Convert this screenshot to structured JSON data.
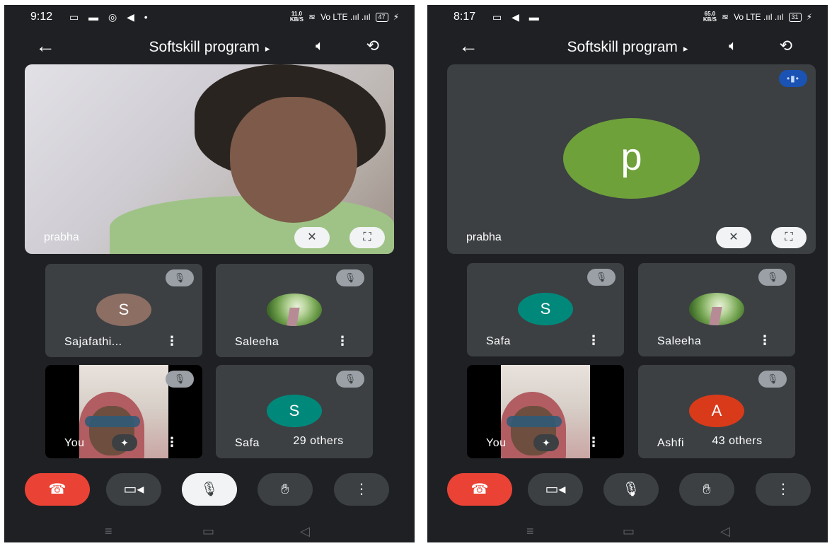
{
  "colors": {
    "background": "#1f2024",
    "tile": "#3c4043",
    "end_call": "#ea4335",
    "avatar_sajafathi": "#8d6e63",
    "avatar_safa": "#00897b",
    "avatar_ashfi": "#d93b1a",
    "avatar_prabha": "#6ea13a",
    "speaking_indicator": "#1a53b3"
  },
  "left": {
    "status": {
      "time": "9:12",
      "app_icons": "▭ ▬ ◎ ◀ •",
      "speed_value": "11.0",
      "speed_unit": "KB/S",
      "wifi_icon": "wifi-icon",
      "signal": "Vo LTE .ııl .ııl",
      "battery": "47"
    },
    "header": {
      "back_icon": "arrow-left-icon",
      "title": "Softskill program",
      "title_arrow": "▸"
    },
    "main": {
      "name": "prabha",
      "pin_icon": "unpin-icon",
      "fullscreen_icon": "fullscreen-icon"
    },
    "tiles": [
      {
        "name": "Sajafathi...",
        "initial": "S",
        "type": "avatar"
      },
      {
        "name": "Saleeha",
        "type": "photo"
      },
      {
        "name": "You",
        "type": "self"
      },
      {
        "name": "Safa",
        "initial": "S",
        "type": "avatar"
      }
    ],
    "more_label": "⋮",
    "mute_glyph": "🎙̸",
    "others": "29 others",
    "controls": {
      "end": "end-call-icon",
      "camera": "video-camera-icon",
      "mic": "mic-off-icon",
      "hand": "raise-hand-icon",
      "more": "more-vert-icon"
    }
  },
  "right": {
    "status": {
      "time": "8:17",
      "app_icons": "▭ ◀ ▬",
      "speed_value": "65.0",
      "speed_unit": "KB/S",
      "wifi_icon": "wifi-icon",
      "signal": "Vo LTE .ııl .ııl",
      "battery": "31"
    },
    "header": {
      "back_icon": "arrow-left-icon",
      "title": "Softskill program",
      "title_arrow": "▸"
    },
    "main": {
      "name": "prabha",
      "initial": "p",
      "speaking_icon": "speaking-indicator-icon",
      "pin_icon": "unpin-icon",
      "fullscreen_icon": "fullscreen-icon"
    },
    "tiles": [
      {
        "name": "Safa",
        "initial": "S",
        "type": "avatar"
      },
      {
        "name": "Saleeha",
        "type": "photo"
      },
      {
        "name": "You",
        "type": "self"
      },
      {
        "name": "Ashfi",
        "initial": "A",
        "type": "avatar"
      }
    ],
    "others": "43 others",
    "controls": {
      "end": "end-call-icon",
      "camera": "video-camera-icon",
      "mic": "mic-on-icon",
      "hand": "raise-hand-icon",
      "more": "more-vert-icon"
    }
  }
}
